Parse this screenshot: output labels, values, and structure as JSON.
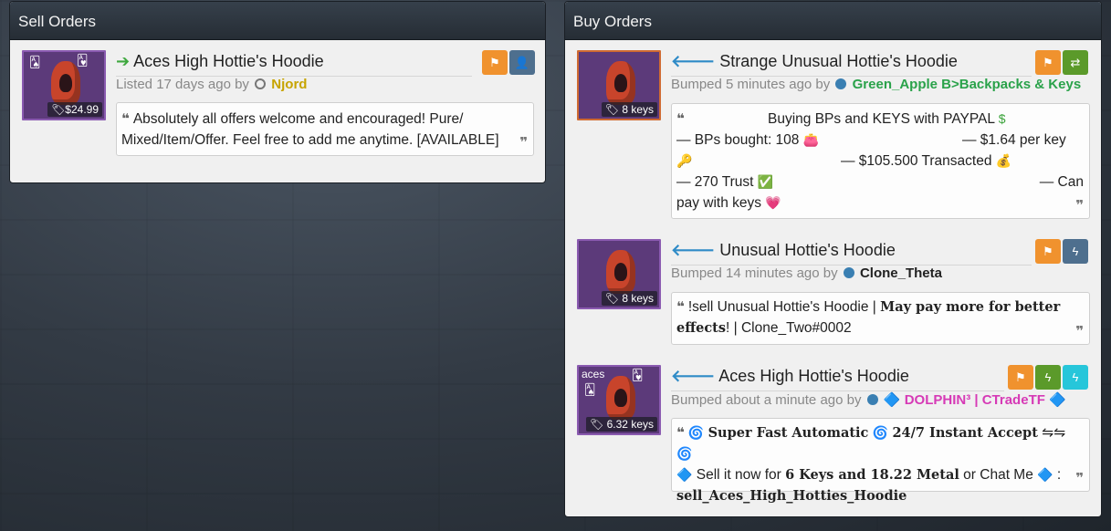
{
  "sell": {
    "header": "Sell Orders",
    "order": {
      "thumb_label": "$24.99",
      "title": "Aces High Hottie's Hoodie",
      "meta_prefix": "Listed 17 days ago by",
      "user": "Njord",
      "quote": "Absolutely all offers welcome and encouraged! Pure/ Mixed/Item/Offer. Feel free to add me anytime. [AVAILABLE]",
      "buttons": [
        "flag-icon",
        "add-friend-icon"
      ]
    }
  },
  "buy": {
    "header": "Buy Orders",
    "orders": [
      {
        "thumb_label": "8 keys",
        "title": "Strange Unusual Hottie's Hoodie",
        "meta_prefix": "Bumped 5 minutes ago by",
        "user": "Green_Apple B>Backpacks & Keys",
        "quote_l1": "Buying BPs and KEYS with PAYPAL",
        "quote_l2a": "— BPs bought: 108",
        "quote_l2b": "— $1.64 per key",
        "quote_l3": "— $105.500 Transacted",
        "quote_l4a": "— 270 Trust",
        "quote_l4b": "— Can",
        "quote_l5": "pay with keys",
        "buttons": [
          "flag-icon",
          "trade-icon"
        ]
      },
      {
        "thumb_label": "8 keys",
        "title": "Unusual Hottie's Hoodie",
        "meta_prefix": "Bumped 14 minutes ago by",
        "user": "Clone_Theta",
        "quote_a": "!sell Unusual Hottie's Hoodie |",
        "quote_b": "May pay more for better effects",
        "quote_c": "! | Clone_Two#0002",
        "buttons": [
          "flag-icon",
          "bolt-icon"
        ]
      },
      {
        "thumb_label": "6.32 keys",
        "thumb_top_label": "aces",
        "title": "Aces High Hottie's Hoodie",
        "meta_prefix": "Bumped about a minute ago by",
        "user": "DOLPHIN³ | CTradeTF",
        "quote_a": "Super Fast Automatic",
        "quote_b": "24/7 Instant Accept",
        "quote_c": "Sell it now for",
        "quote_d": "6 Keys and 18.22 Metal",
        "quote_e": "or Chat Me",
        "quote_f": "sell_Aces_High_Hotties_Hoodie",
        "buttons": [
          "flag-icon",
          "bolt-icon",
          "bolt-icon"
        ]
      }
    ]
  }
}
